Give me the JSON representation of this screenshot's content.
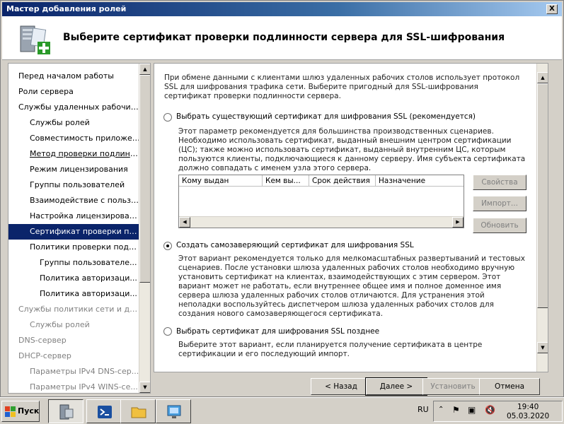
{
  "window": {
    "title": "Мастер добавления ролей",
    "close": "X"
  },
  "header": {
    "title": "Выберите сертификат проверки подлинности сервера для SSL-шифрования"
  },
  "nav": {
    "items": [
      {
        "label": "Перед началом работы",
        "state": "normal"
      },
      {
        "label": "Роли сервера",
        "state": "normal"
      },
      {
        "label": "Службы удаленных рабочих ст...",
        "state": "normal"
      },
      {
        "label": "Службы ролей",
        "state": "normal"
      },
      {
        "label": "Совместимость приложений",
        "state": "normal"
      },
      {
        "label": "Метод проверки подлинности",
        "state": "link"
      },
      {
        "label": "Режим лицензирования",
        "state": "normal"
      },
      {
        "label": "Группы пользователей",
        "state": "normal"
      },
      {
        "label": "Взаимодействие с пользо...",
        "state": "normal"
      },
      {
        "label": "Настройка лицензирован...",
        "state": "normal"
      },
      {
        "label": "Сертификат проверки по...",
        "state": "selected"
      },
      {
        "label": "Политики проверки подл...",
        "state": "normal"
      },
      {
        "label": "Группы пользователе...",
        "state": "normal"
      },
      {
        "label": "Политика авторизаци...",
        "state": "normal"
      },
      {
        "label": "Политика авторизаци...",
        "state": "normal"
      },
      {
        "label": "Службы политики сети и до...",
        "state": "dim"
      },
      {
        "label": "Службы ролей",
        "state": "dim"
      },
      {
        "label": "DNS-сервер",
        "state": "dim"
      },
      {
        "label": "DHCP-сервер",
        "state": "dim"
      },
      {
        "label": "Параметры IPv4 DNS-сер...",
        "state": "dim"
      },
      {
        "label": "Параметры IPv4 WINS-се...",
        "state": "dim"
      }
    ]
  },
  "content": {
    "intro": "При обмене данными с клиентами шлюз удаленных рабочих столов использует протокол SSL для шифрования трафика сети. Выберите пригодный для SSL-шифрования сертификат проверки подлинности сервера.",
    "option1": {
      "label": "Выбрать существующий сертификат для шифрования SSL (рекомендуется)",
      "desc": "Этот параметр рекомендуется для большинства производственных сценариев. Необходимо использовать сертификат, выданный внешним центром сертификации (ЦС); также можно использовать сертификат, выданный внутренним ЦС, которым пользуются клиенты, подключающиеся к данному серверу. Имя субъекта сертификата должно совпадать с именем узла этого сервера.",
      "selected": false
    },
    "table": {
      "columns": [
        "Кому выдан",
        "Кем вы...",
        "Срок действия",
        "Назначение"
      ]
    },
    "side_buttons": {
      "properties": "Свойства",
      "import": "Импорт...",
      "refresh": "Обновить"
    },
    "option2": {
      "label": "Создать самозаверяющий сертификат для шифрования SSL",
      "desc": "Этот вариант рекомендуется только для мелкомасштабных развертываний и тестовых сценариев. После установки шлюза удаленных рабочих столов необходимо вручную установить сертификат на клиентах, взаимодействующих с этим сервером. Этот вариант может не работать, если внутреннее общее имя и полное доменное имя сервера шлюза удаленных рабочих столов отличаются. Для устранения этой неполадки воспользуйтесь диспетчером шлюза удаленных рабочих столов для создания нового самозаверяющегося сертификата.",
      "selected": true
    },
    "option3": {
      "label": "Выбрать сертификат для шифрования SSL позднее",
      "desc": "Выберите этот вариант, если планируется получение сертификата в центре сертификации и его последующий импорт.",
      "selected": false
    }
  },
  "buttons": {
    "back": "< Назад",
    "next": "Далее >",
    "install": "Установить",
    "cancel": "Отмена"
  },
  "taskbar": {
    "start": "Пуск",
    "lang": "RU",
    "time": "19:40",
    "date": "05.03.2020"
  }
}
